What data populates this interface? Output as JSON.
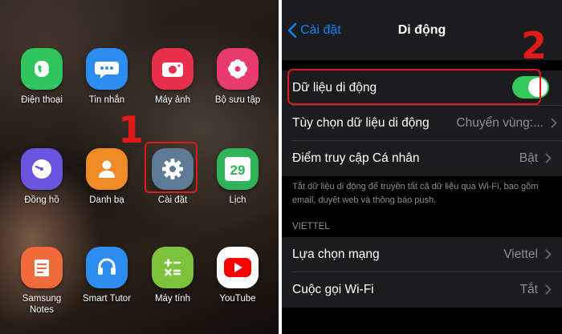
{
  "android": {
    "apps": [
      {
        "label": "Điện thoại"
      },
      {
        "label": "Tin nhắn"
      },
      {
        "label": "Máy ảnh"
      },
      {
        "label": "Bộ sưu tập"
      },
      {
        "label": "Đồng hồ"
      },
      {
        "label": "Danh bạ"
      },
      {
        "label": "Cài đặt"
      },
      {
        "label": "Lịch",
        "date": "29"
      },
      {
        "label": "Samsung\nNotes"
      },
      {
        "label": "Smart Tutor"
      },
      {
        "label": "Máy tính"
      },
      {
        "label": "YouTube"
      }
    ],
    "step_number": "1"
  },
  "ios": {
    "back_label": "Cài đặt",
    "title": "Di động",
    "step_number": "2",
    "mobile_data": {
      "label": "Dữ liệu di động",
      "enabled": true
    },
    "data_options": {
      "label": "Tùy chọn dữ liệu di động",
      "value": "Chuyển vùng:..."
    },
    "hotspot": {
      "label": "Điểm truy cập Cá nhân",
      "value": "Bật"
    },
    "footnote": "Tắt dữ liệu di động để truyền tất cả dữ liệu qua Wi-Fi, bao gồm email, duyệt web và thông báo push.",
    "carrier_header": "VIETTEL",
    "network_select": {
      "label": "Lựa chọn mạng",
      "value": "Viettel"
    },
    "wifi_calling": {
      "label": "Cuộc gọi Wi-Fi",
      "value": "Tắt"
    }
  }
}
